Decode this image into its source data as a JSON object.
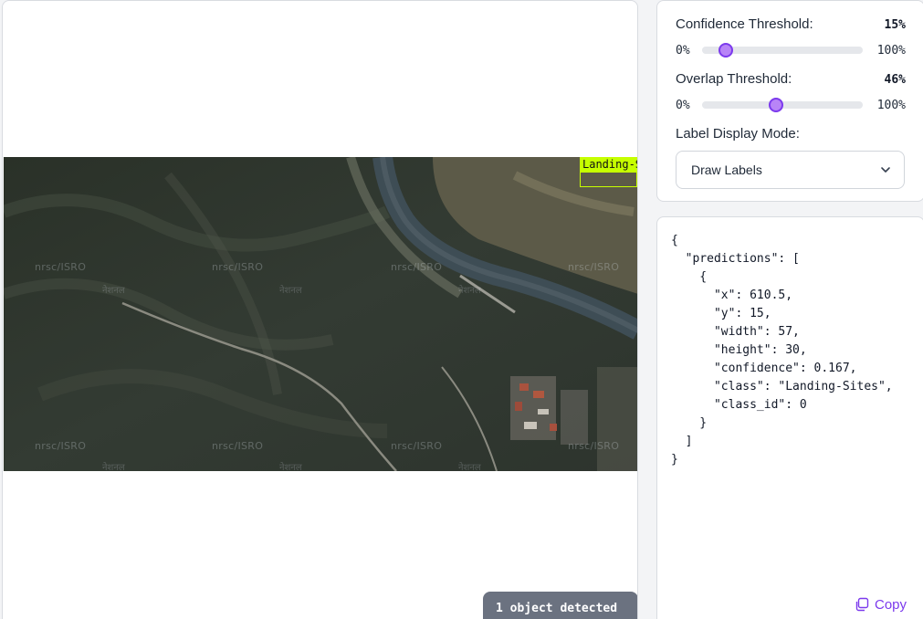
{
  "detection": {
    "box_label": "Landing-Sites",
    "count_text": "1 object detected"
  },
  "watermarks": {
    "text": "nrsc/ISRO",
    "sub": "नेशनल"
  },
  "settings": {
    "confidence": {
      "label": "Confidence Threshold:",
      "value_text": "15%",
      "value": 15,
      "min": "0%",
      "max": "100%"
    },
    "overlap": {
      "label": "Overlap Threshold:",
      "value_text": "46%",
      "value": 46,
      "min": "0%",
      "max": "100%"
    },
    "label_mode": {
      "label": "Label Display Mode:",
      "selected": "Draw Labels"
    },
    "accent_color": "#7c3aed"
  },
  "output": {
    "json_text": "{\n  \"predictions\": [\n    {\n      \"x\": 610.5,\n      \"y\": 15,\n      \"width\": 57,\n      \"height\": 30,\n      \"confidence\": 0.167,\n      \"class\": \"Landing-Sites\",\n      \"class_id\": 0\n    }\n  ]\n}",
    "copy_label": "Copy"
  }
}
